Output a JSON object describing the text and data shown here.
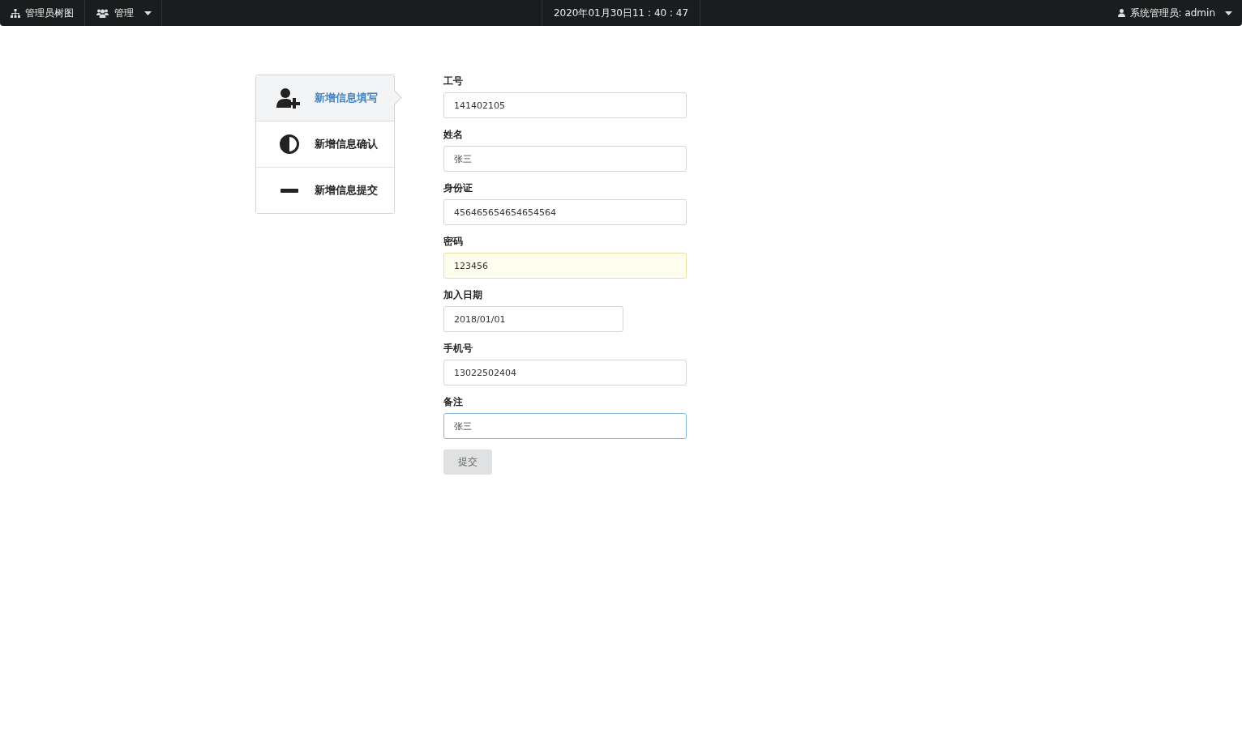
{
  "top_bar": {
    "left_items": [
      {
        "label": "管理员树图",
        "dropdown": false
      },
      {
        "label": "管理",
        "dropdown": true
      }
    ],
    "datetime": "2020年01月30日11 : 40 : 47",
    "user": {
      "label": "系统管理员: admin",
      "dropdown": true
    }
  },
  "steps": [
    {
      "label": "新增信息填写",
      "selected": true
    },
    {
      "label": "新增信息确认",
      "selected": false
    },
    {
      "label": "新增信息提交",
      "selected": false
    }
  ],
  "form": {
    "fields": [
      {
        "label": "工号",
        "value": "141402105",
        "autofilled": false,
        "focused": false,
        "kind": "text"
      },
      {
        "label": "姓名",
        "value": "张三",
        "autofilled": false,
        "focused": false,
        "kind": "text"
      },
      {
        "label": "身份证",
        "value": "456465654654654564",
        "autofilled": false,
        "focused": false,
        "kind": "text"
      },
      {
        "label": "密码",
        "value": "123456",
        "autofilled": true,
        "focused": false,
        "kind": "text"
      },
      {
        "label": "加入日期",
        "value": "2018/01/01",
        "autofilled": false,
        "focused": false,
        "kind": "date"
      },
      {
        "label": "手机号",
        "value": "13022502404",
        "autofilled": false,
        "focused": false,
        "kind": "text"
      },
      {
        "label": "备注",
        "value": "张三",
        "autofilled": false,
        "focused": true,
        "kind": "text"
      }
    ],
    "submit": "提交"
  }
}
